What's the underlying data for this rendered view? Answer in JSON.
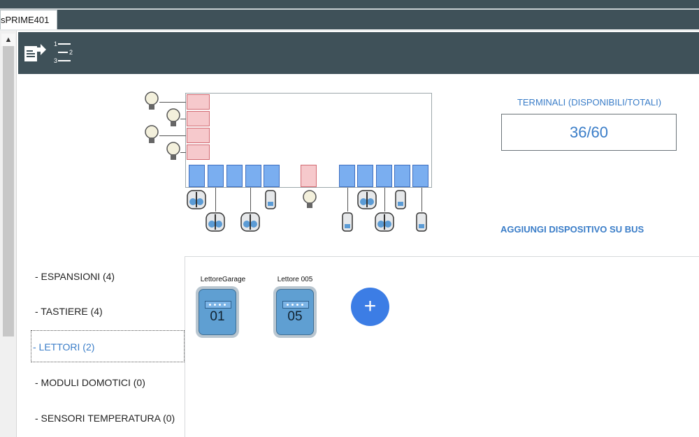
{
  "window": {
    "tab_label": "sPRIME401"
  },
  "toolbar": {
    "icons": [
      "export-icon",
      "ordered-list-icon"
    ],
    "export_tooltip": "",
    "list_tooltip": ""
  },
  "terminals": {
    "label": "TERMINALI (DISPONIBILI/TOTALI)",
    "value": "36/60"
  },
  "add_bus": {
    "label": "AGGIUNGI DISPOSITIVO SU BUS"
  },
  "categories": [
    {
      "label": "- ESPANSIONI (4)",
      "selected": false
    },
    {
      "label": "- TASTIERE (4)",
      "selected": false
    },
    {
      "label": "- LETTORI (2)",
      "selected": true
    },
    {
      "label": "- MODULI DOMOTICI (0)",
      "selected": false
    },
    {
      "label": "- SENSORI TEMPERATURA (0)",
      "selected": false
    }
  ],
  "devices": [
    {
      "name": "LettoreGarage",
      "number": "01"
    },
    {
      "name": "Lettore 005",
      "number": "05"
    }
  ],
  "add_device": {
    "symbol": "+"
  },
  "colors": {
    "accent": "#3a7dc8",
    "toolbar": "#3f5159",
    "device": "#5f9fd2",
    "add_button": "#3c7de5"
  }
}
